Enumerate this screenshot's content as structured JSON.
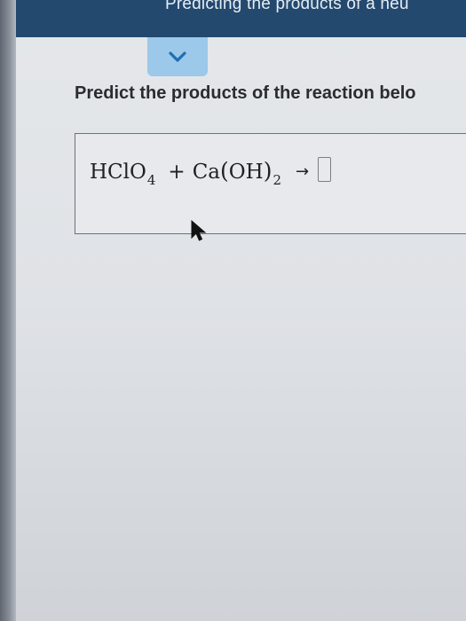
{
  "header": {
    "title": "Predicting the products of a neu"
  },
  "toggle": {
    "icon": "chevron-down-icon",
    "accent": "#9cc8ea"
  },
  "question": {
    "prompt": "Predict the products of the reaction belo"
  },
  "equation": {
    "reactant1_main": "HClO",
    "reactant1_sub": "4",
    "plus": "+",
    "reactant2_element": "Ca",
    "reactant2_open": "(",
    "reactant2_group": "OH",
    "reactant2_close": ")",
    "reactant2_sub": "2",
    "arrow": "→",
    "products_value": ""
  },
  "colors": {
    "header_bg": "#24496f",
    "panel_bg": "#e4e7ea"
  }
}
